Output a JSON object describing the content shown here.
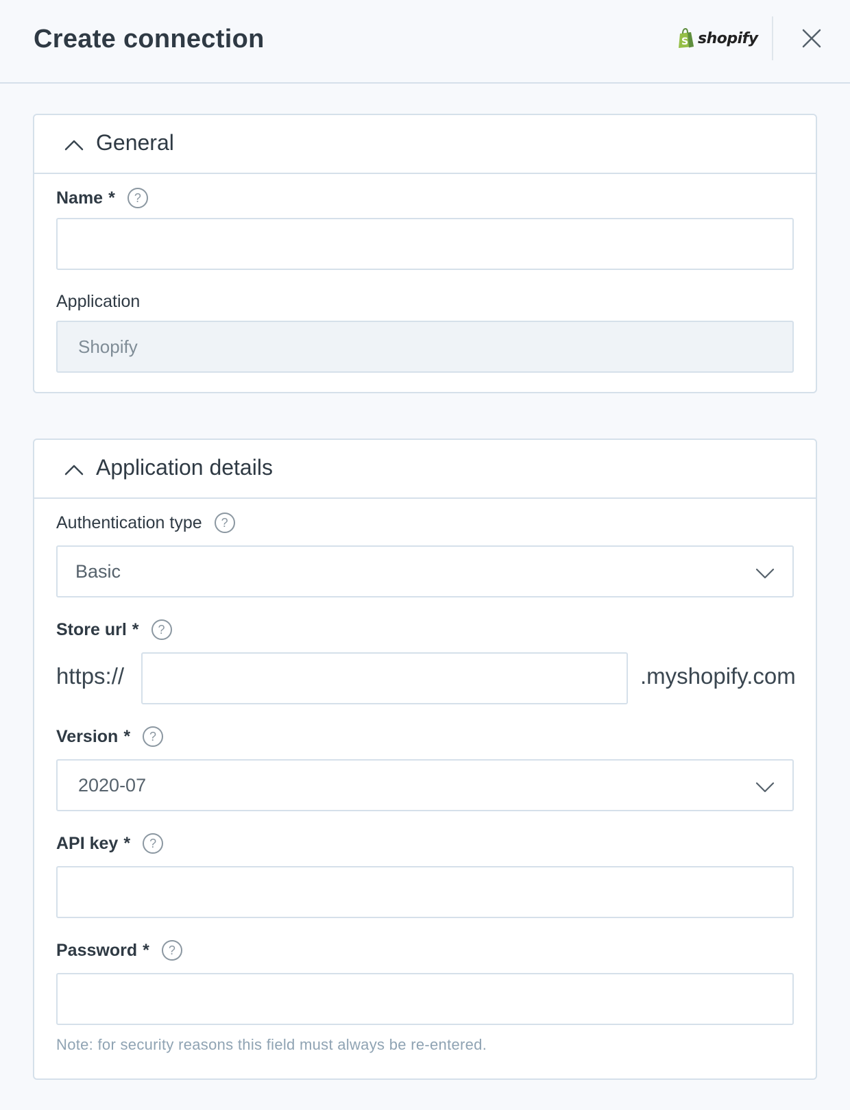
{
  "header": {
    "title": "Create connection",
    "brand_name": "shopify",
    "brand_color": "#95bf47"
  },
  "general": {
    "section_title": "General",
    "name_label": "Name",
    "name_required": "*",
    "name_value": "",
    "application_label": "Application",
    "application_value": "Shopify"
  },
  "details": {
    "section_title": "Application details",
    "auth_label": "Authentication type",
    "auth_value": "Basic",
    "store_url_label": "Store url",
    "store_url_required": "*",
    "store_url_prefix": "https://",
    "store_url_suffix": ".myshopify.com",
    "store_url_value": "",
    "version_label": "Version",
    "version_required": "*",
    "version_value": "2020-07",
    "api_key_label": "API key",
    "api_key_required": "*",
    "api_key_value": "",
    "password_label": "Password",
    "password_required": "*",
    "password_value": "",
    "password_note": "Note: for security reasons this field must always be re-entered."
  },
  "icons": {
    "help": "?",
    "collapse": "chevron-up-icon",
    "dropdown": "chevron-down-icon",
    "close": "close-icon"
  }
}
